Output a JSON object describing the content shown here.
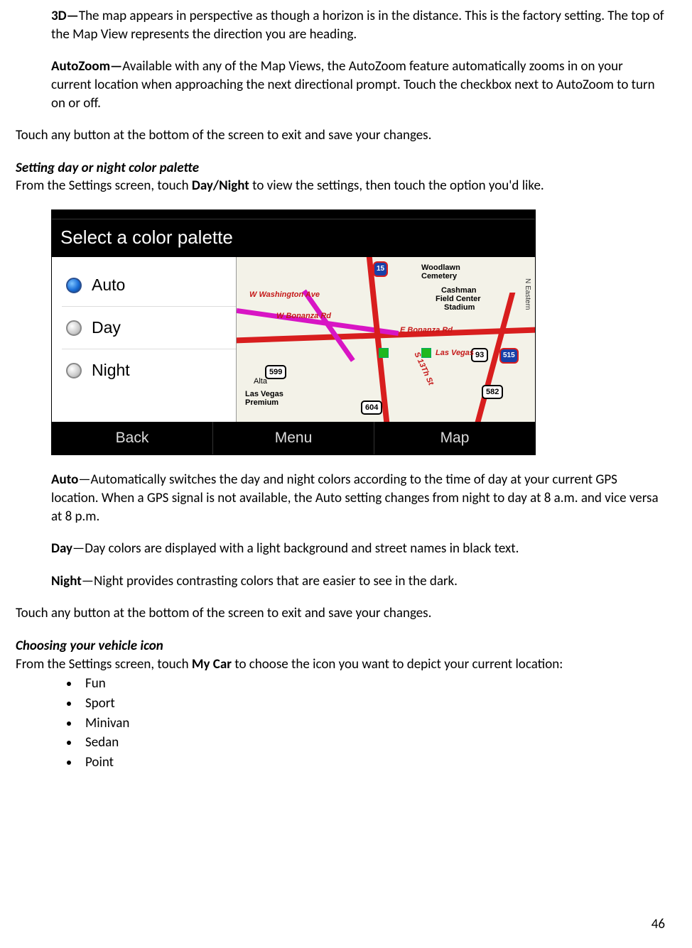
{
  "para": {
    "p3d_label": "3D—",
    "p3d": "The map appears in perspective as though a horizon is in the distance. This is the factory setting. The top of the Map View represents the direction you are heading.",
    "paz_label": "AutoZoom—",
    "paz": "Available with any of the Map Views, the AutoZoom feature automatically zooms in on your current location when approaching the next directional prompt. Touch the checkbox next to AutoZoom to turn on or off.",
    "exit1": "Touch any button at the bottom of the screen to exit and save your changes.",
    "heading_palette": "Setting day or night color palette",
    "palette_intro_a": "From the Settings screen, touch ",
    "palette_intro_bold": "Day/Night",
    "palette_intro_b": " to view the settings, then touch the option you'd like.",
    "auto_label": "Auto",
    "auto_desc": "—Automatically switches the day and night colors according to the time of day at your current GPS location. When a GPS signal is not available, the Auto setting changes from night to day at 8 a.m. and vice versa at 8 p.m.",
    "day_label": "Day",
    "day_desc": "—Day colors are displayed with a light background and street names in black text.",
    "night_label": "Night",
    "night_desc": "—Night provides contrasting colors that are easier to see in the dark.",
    "exit2": "Touch any button at the bottom of the screen to exit and save your changes.",
    "heading_vehicle": "Choosing your vehicle icon",
    "vehicle_intro_a": "From the Settings screen, touch ",
    "vehicle_intro_bold": "My Car",
    "vehicle_intro_b": " to choose the icon you want to depict your current location:"
  },
  "vehicle_options": [
    "Fun",
    "Sport",
    "Minivan",
    "Sedan",
    "Point"
  ],
  "screenshot": {
    "title": "Select a color palette",
    "options": {
      "auto": "Auto",
      "day": "Day",
      "night": "Night"
    },
    "bottom": {
      "back": "Back",
      "menu": "Menu",
      "map": "Map"
    },
    "maplabels": {
      "woodlawn": "Woodlawn",
      "cemetery": "Cemetery",
      "cashman1": "Cashman",
      "cashman2": "Field Center",
      "cashman3": "Stadium",
      "wash": "W Washington Ave",
      "wbonanza": "W Bonanza Rd",
      "ebonanza": "E Bonanza Rd",
      "alta": "Alta",
      "lvp1": "Las Vegas",
      "lvp2": "Premium",
      "lasvegas": "Las Vegas",
      "neastern": "N Eastern",
      "s13th": "S 13Th St",
      "r599": "599",
      "r604": "604",
      "r582": "582",
      "r93": "93",
      "r515": "515",
      "r15": "15"
    }
  },
  "page_number": "46"
}
